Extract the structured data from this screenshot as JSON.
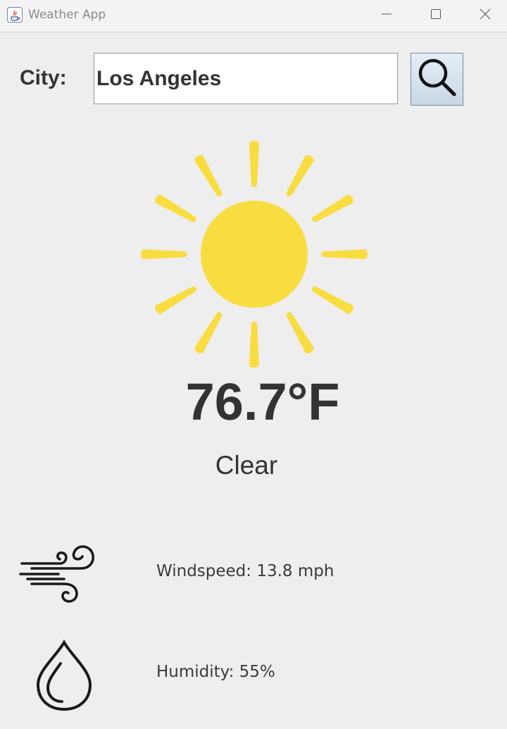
{
  "window": {
    "title": "Weather App",
    "app_icon": "java-cup-icon",
    "controls": [
      "minimize-icon",
      "maximize-icon",
      "close-icon"
    ]
  },
  "search": {
    "label": "City:",
    "value": "Los Angeles",
    "button_icon": "magnifier-icon"
  },
  "weather": {
    "icon": "sun-icon",
    "icon_color": "#f9dc3f",
    "temperature": "76.7°F",
    "condition": "Clear"
  },
  "details": {
    "windspeed_icon": "wind-icon",
    "windspeed": "Windspeed: 13.8 mph",
    "humidity_icon": "water-drop-icon",
    "humidity": "Humidity: 55%"
  }
}
